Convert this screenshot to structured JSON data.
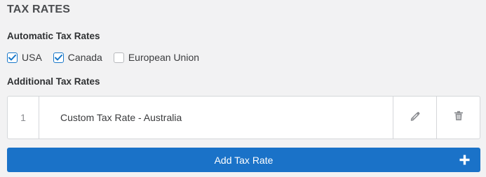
{
  "section": {
    "title": "TAX RATES"
  },
  "automatic": {
    "label": "Automatic Tax Rates",
    "options": [
      {
        "label": "USA",
        "checked": true
      },
      {
        "label": "Canada",
        "checked": true
      },
      {
        "label": "European Union",
        "checked": false
      }
    ]
  },
  "additional": {
    "label": "Additional Tax Rates",
    "rows": [
      {
        "index": "1",
        "name": "Custom Tax Rate - Australia",
        "edit_icon": "pencil-icon",
        "delete_icon": "trash-icon"
      }
    ]
  },
  "add_button": {
    "label": "Add Tax Rate",
    "icon": "plus-icon"
  },
  "colors": {
    "accent": "#1a72c8",
    "background": "#f2f2f3"
  }
}
